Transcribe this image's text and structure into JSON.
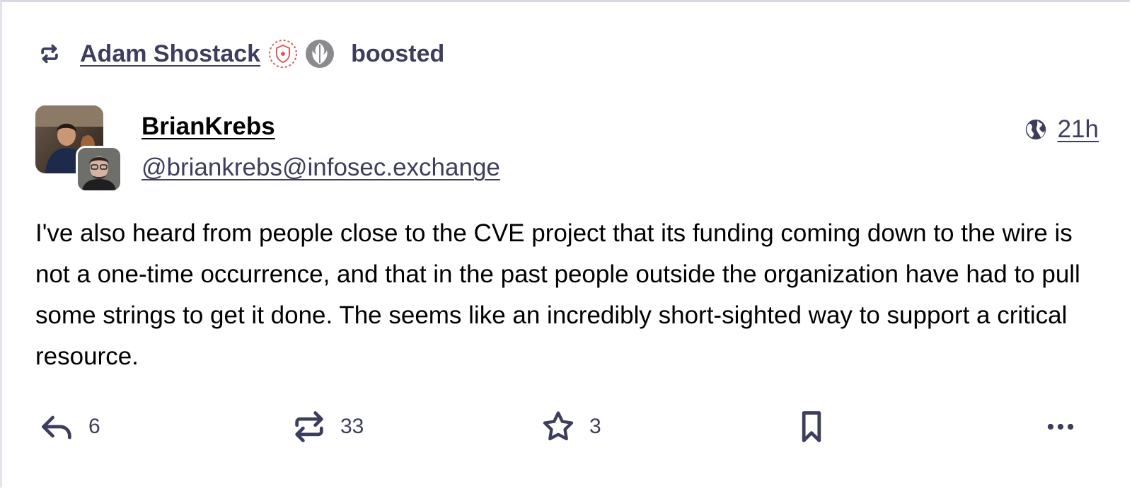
{
  "boost": {
    "booster_name": "Adam Shostack",
    "verb": "boosted",
    "icons": [
      "boost-icon",
      "shield-emoji-icon",
      "rebel-emoji-icon"
    ]
  },
  "author": {
    "display_name": "BrianKrebs",
    "handle": "@briankrebs@infosec.exchange"
  },
  "meta": {
    "visibility_icon": "globe-icon",
    "timestamp": "21h"
  },
  "status": {
    "text": "I've also heard from people close to the CVE project that its funding coming down to the wire is not a one-time occurrence, and that in the past people outside the organization have had to pull some strings to get it done. The seems like an incredibly short-sighted way to support a critical resource."
  },
  "actions": {
    "reply_count": "6",
    "boost_count": "33",
    "favourite_count": "3",
    "icons": [
      "reply-icon",
      "boost-icon",
      "star-icon",
      "bookmark-icon",
      "more-icon"
    ]
  },
  "colors": {
    "accent": "#3d3d5e",
    "text": "#000000",
    "border": "#d9d9e6",
    "shield_emoji": "#e05a5a"
  }
}
